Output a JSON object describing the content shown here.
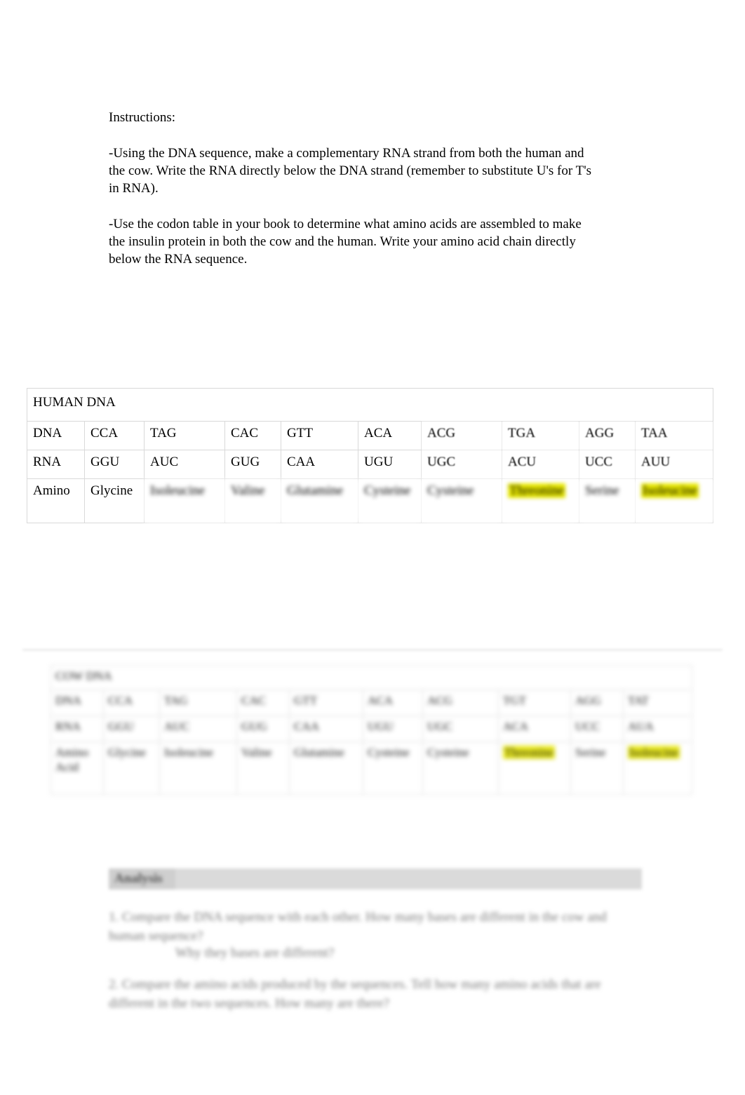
{
  "instructions": {
    "heading": "Instructions:",
    "bullet_1": "-Using the DNA sequence, make a complementary RNA strand from both the human and the cow. Write the RNA directly below the DNA strand (remember to substitute U's for T's in RNA).",
    "bullet_2": "-Use the codon table in your book to determine what amino acids are assembled to make the insulin protein in both the cow and the human. Write your amino acid chain directly below the RNA sequence."
  },
  "colors": {
    "highlight": "#e8e800",
    "table_border": "#d9d9d9",
    "analysis_bar": "#d6d6d6",
    "page_background": "#ffffff"
  },
  "human_table": {
    "title": "HUMAN DNA",
    "rows": [
      {
        "label": "DNA",
        "cells": [
          "CCA",
          "TAG",
          "CAC",
          "GTT",
          "ACA",
          "ACG",
          "TGA",
          "AGG",
          "TAA"
        ]
      },
      {
        "label": "RNA",
        "cells": [
          "GGU",
          "AUC",
          "GUG",
          "CAA",
          "UGU",
          "UGC",
          "ACU",
          "UCC",
          "AUU"
        ]
      },
      {
        "label": "Amino",
        "cells": [
          "Glycine",
          "Isoleucine",
          "Valine",
          "Glutamine",
          "Cysteine",
          "Cysteine",
          "Threonine",
          "Serine",
          "Isoleucine"
        ],
        "highlighted": [
          false,
          false,
          false,
          false,
          false,
          false,
          true,
          false,
          true
        ]
      }
    ]
  },
  "cow_table": {
    "title": "COW DNA",
    "rows": [
      {
        "label": "DNA",
        "cells": [
          "CCA",
          "TAG",
          "CAC",
          "GTT",
          "ACA",
          "ACG",
          "TGT",
          "AGG",
          "TAT"
        ]
      },
      {
        "label": "RNA",
        "cells": [
          "GGU",
          "AUC",
          "GUG",
          "CAA",
          "UGU",
          "UGC",
          "ACA",
          "UCC",
          "AUA"
        ]
      },
      {
        "label": "Amino Acid",
        "cells": [
          "Glycine",
          "Isoleucine",
          "Valine",
          "Glutamine",
          "Cysteine",
          "Cysteine",
          "Threonine",
          "Serine",
          "Isoleucine"
        ],
        "highlighted": [
          false,
          false,
          false,
          false,
          false,
          false,
          true,
          false,
          true
        ]
      }
    ]
  },
  "analysis": {
    "heading": "Analysis",
    "question_1": "1. Compare the DNA sequence with each other. How many bases are different in the cow and human sequence?",
    "question_1_sub": "Why they bases are different?",
    "question_2": "2. Compare the amino acids produced by the sequences. Tell how many amino acids that are different in the two sequences. How many are there?"
  }
}
